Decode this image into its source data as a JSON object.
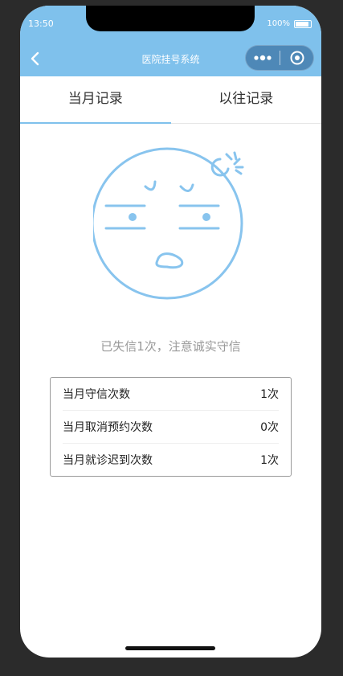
{
  "status": {
    "time": "13:50",
    "battery": "100%"
  },
  "nav": {
    "title": "医院挂号系统"
  },
  "tabs": [
    {
      "label": "当月记录"
    },
    {
      "label": "以往记录"
    }
  ],
  "message": "已失信1次，注意诚实守信",
  "stats": [
    {
      "label": "当月守信次数",
      "value": "1次"
    },
    {
      "label": "当月取消预约次数",
      "value": "0次"
    },
    {
      "label": "当月就诊迟到次数",
      "value": "1次"
    }
  ],
  "colors": {
    "accent": "#7fc1ec",
    "face": "#88c4ee"
  }
}
